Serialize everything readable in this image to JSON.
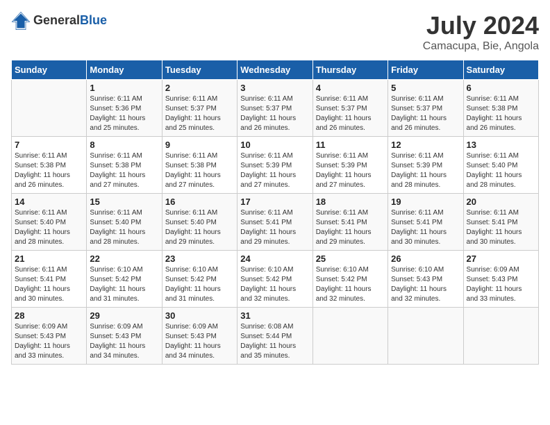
{
  "header": {
    "logo_general": "General",
    "logo_blue": "Blue",
    "month_title": "July 2024",
    "location": "Camacupa, Bie, Angola"
  },
  "calendar": {
    "days_of_week": [
      "Sunday",
      "Monday",
      "Tuesday",
      "Wednesday",
      "Thursday",
      "Friday",
      "Saturday"
    ],
    "weeks": [
      [
        {
          "day": "",
          "info": ""
        },
        {
          "day": "1",
          "info": "Sunrise: 6:11 AM\nSunset: 5:36 PM\nDaylight: 11 hours\nand 25 minutes."
        },
        {
          "day": "2",
          "info": "Sunrise: 6:11 AM\nSunset: 5:37 PM\nDaylight: 11 hours\nand 25 minutes."
        },
        {
          "day": "3",
          "info": "Sunrise: 6:11 AM\nSunset: 5:37 PM\nDaylight: 11 hours\nand 26 minutes."
        },
        {
          "day": "4",
          "info": "Sunrise: 6:11 AM\nSunset: 5:37 PM\nDaylight: 11 hours\nand 26 minutes."
        },
        {
          "day": "5",
          "info": "Sunrise: 6:11 AM\nSunset: 5:37 PM\nDaylight: 11 hours\nand 26 minutes."
        },
        {
          "day": "6",
          "info": "Sunrise: 6:11 AM\nSunset: 5:38 PM\nDaylight: 11 hours\nand 26 minutes."
        }
      ],
      [
        {
          "day": "7",
          "info": "Sunrise: 6:11 AM\nSunset: 5:38 PM\nDaylight: 11 hours\nand 26 minutes."
        },
        {
          "day": "8",
          "info": "Sunrise: 6:11 AM\nSunset: 5:38 PM\nDaylight: 11 hours\nand 27 minutes."
        },
        {
          "day": "9",
          "info": "Sunrise: 6:11 AM\nSunset: 5:38 PM\nDaylight: 11 hours\nand 27 minutes."
        },
        {
          "day": "10",
          "info": "Sunrise: 6:11 AM\nSunset: 5:39 PM\nDaylight: 11 hours\nand 27 minutes."
        },
        {
          "day": "11",
          "info": "Sunrise: 6:11 AM\nSunset: 5:39 PM\nDaylight: 11 hours\nand 27 minutes."
        },
        {
          "day": "12",
          "info": "Sunrise: 6:11 AM\nSunset: 5:39 PM\nDaylight: 11 hours\nand 28 minutes."
        },
        {
          "day": "13",
          "info": "Sunrise: 6:11 AM\nSunset: 5:40 PM\nDaylight: 11 hours\nand 28 minutes."
        }
      ],
      [
        {
          "day": "14",
          "info": "Sunrise: 6:11 AM\nSunset: 5:40 PM\nDaylight: 11 hours\nand 28 minutes."
        },
        {
          "day": "15",
          "info": "Sunrise: 6:11 AM\nSunset: 5:40 PM\nDaylight: 11 hours\nand 28 minutes."
        },
        {
          "day": "16",
          "info": "Sunrise: 6:11 AM\nSunset: 5:40 PM\nDaylight: 11 hours\nand 29 minutes."
        },
        {
          "day": "17",
          "info": "Sunrise: 6:11 AM\nSunset: 5:41 PM\nDaylight: 11 hours\nand 29 minutes."
        },
        {
          "day": "18",
          "info": "Sunrise: 6:11 AM\nSunset: 5:41 PM\nDaylight: 11 hours\nand 29 minutes."
        },
        {
          "day": "19",
          "info": "Sunrise: 6:11 AM\nSunset: 5:41 PM\nDaylight: 11 hours\nand 30 minutes."
        },
        {
          "day": "20",
          "info": "Sunrise: 6:11 AM\nSunset: 5:41 PM\nDaylight: 11 hours\nand 30 minutes."
        }
      ],
      [
        {
          "day": "21",
          "info": "Sunrise: 6:11 AM\nSunset: 5:41 PM\nDaylight: 11 hours\nand 30 minutes."
        },
        {
          "day": "22",
          "info": "Sunrise: 6:10 AM\nSunset: 5:42 PM\nDaylight: 11 hours\nand 31 minutes."
        },
        {
          "day": "23",
          "info": "Sunrise: 6:10 AM\nSunset: 5:42 PM\nDaylight: 11 hours\nand 31 minutes."
        },
        {
          "day": "24",
          "info": "Sunrise: 6:10 AM\nSunset: 5:42 PM\nDaylight: 11 hours\nand 32 minutes."
        },
        {
          "day": "25",
          "info": "Sunrise: 6:10 AM\nSunset: 5:42 PM\nDaylight: 11 hours\nand 32 minutes."
        },
        {
          "day": "26",
          "info": "Sunrise: 6:10 AM\nSunset: 5:43 PM\nDaylight: 11 hours\nand 32 minutes."
        },
        {
          "day": "27",
          "info": "Sunrise: 6:09 AM\nSunset: 5:43 PM\nDaylight: 11 hours\nand 33 minutes."
        }
      ],
      [
        {
          "day": "28",
          "info": "Sunrise: 6:09 AM\nSunset: 5:43 PM\nDaylight: 11 hours\nand 33 minutes."
        },
        {
          "day": "29",
          "info": "Sunrise: 6:09 AM\nSunset: 5:43 PM\nDaylight: 11 hours\nand 34 minutes."
        },
        {
          "day": "30",
          "info": "Sunrise: 6:09 AM\nSunset: 5:43 PM\nDaylight: 11 hours\nand 34 minutes."
        },
        {
          "day": "31",
          "info": "Sunrise: 6:08 AM\nSunset: 5:44 PM\nDaylight: 11 hours\nand 35 minutes."
        },
        {
          "day": "",
          "info": ""
        },
        {
          "day": "",
          "info": ""
        },
        {
          "day": "",
          "info": ""
        }
      ]
    ]
  }
}
